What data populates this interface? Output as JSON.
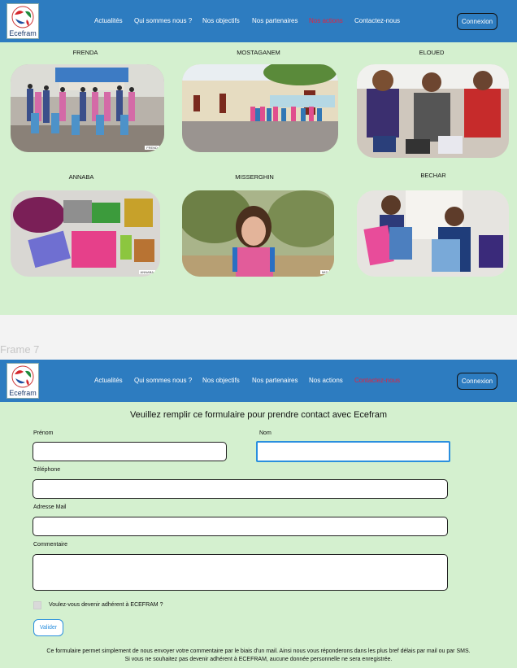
{
  "brand": {
    "logo_text": "Ecefram"
  },
  "frame_a": {
    "nav": [
      "Actualités",
      "Qui sommes nous ?",
      "Nos objectifs",
      "Nos partenaires",
      "Nos actions",
      "Contactez-nous"
    ],
    "active_index": 4,
    "login_label": "Connexion",
    "cities": [
      {
        "name": "FRENDA",
        "tag": "FREND"
      },
      {
        "name": "MOSTAGANEM",
        "tag": ""
      },
      {
        "name": "ELOUED",
        "tag": ""
      },
      {
        "name": "ANNABA",
        "tag": "ANNABA"
      },
      {
        "name": "MISSERGHIN",
        "tag": "MIS"
      },
      {
        "name": "BECHAR",
        "tag": ""
      }
    ]
  },
  "frame_caption": "Frame 7",
  "frame_b": {
    "nav": [
      "Actualités",
      "Qui sommes nous ?",
      "Nos objectifs",
      "Nos partenaires",
      "Nos actions",
      "Contactez-nous"
    ],
    "active_index": 5,
    "login_label": "Connexion",
    "form": {
      "title": "Veuillez remplir ce formulaire pour prendre contact avec Ecefram",
      "firstname_label": "Prénom",
      "lastname_label": "Nom",
      "phone_label": "Téléphone",
      "email_label": "Adresse Mail",
      "comment_label": "Commentaire",
      "member_label": "Voulez-vous devenir adhérent à ECEFRAM ?",
      "submit_label": "Valider",
      "notice_line1": "Ce formulaire permet simplement de nous envoyer votre commentaire par le biais d'un mail. Ainsi nous vous réponderons dans les plus bref délais par mail ou par SMS.",
      "notice_line2": "Si vous ne souhaitez pas devenir adhérent à ECEFRAM, aucune donnée personnelle ne sera enregistrée."
    }
  }
}
